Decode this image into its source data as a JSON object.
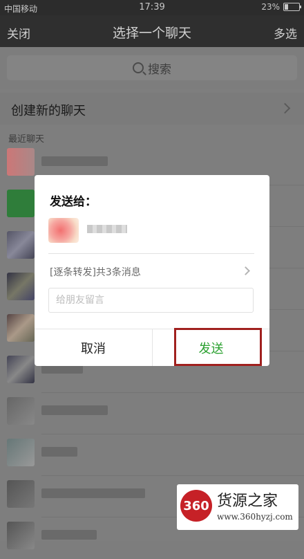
{
  "status_bar": {
    "carrier": "中国移动",
    "time": "17:39",
    "battery": "23%",
    "battery_level": 0.23
  },
  "nav": {
    "close_label": "关闭",
    "title": "选择一个聊天",
    "multi_select_label": "多选"
  },
  "search": {
    "label": "搜索",
    "icon": "search-icon"
  },
  "create_chat": {
    "label": "创建新的聊天"
  },
  "recent_header": "最近聊天",
  "dialog": {
    "send_to_label": "发送给：",
    "message_summary": "[逐条转发]共3条消息",
    "note_placeholder": "给朋友留言",
    "cancel_label": "取消",
    "send_label": "发送"
  },
  "watermark": {
    "logo_text": "360",
    "name": "货源之家",
    "url": "www.360hyzj.com"
  },
  "colors": {
    "send_green": "#2aa02f",
    "highlight_red": "#a0201e",
    "logo_red": "#c62127"
  }
}
